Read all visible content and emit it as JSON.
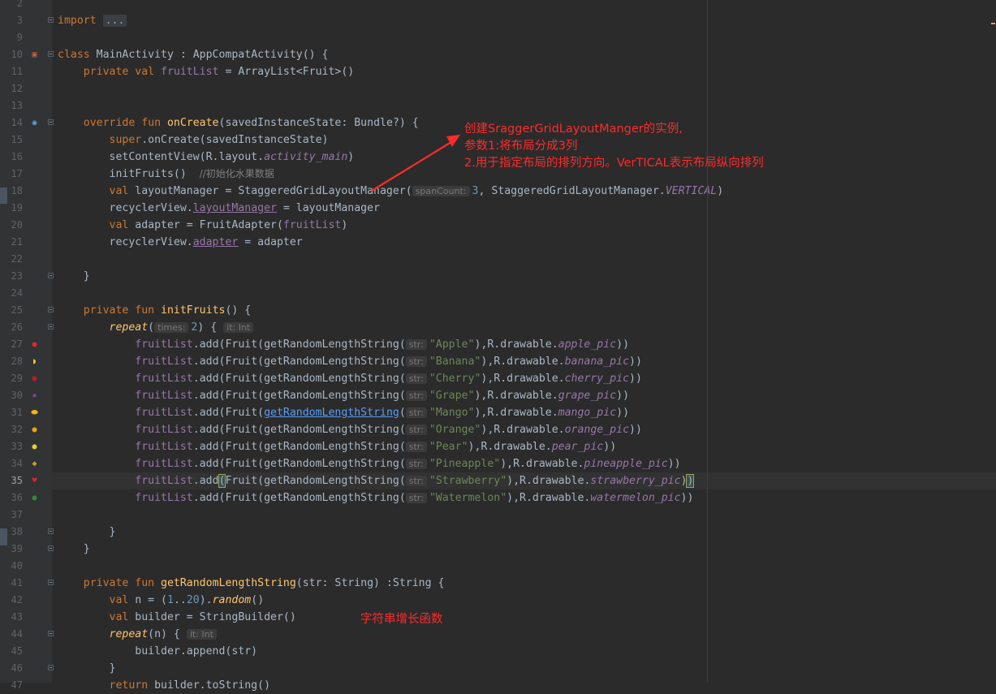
{
  "editor": {
    "language": "Kotlin",
    "colors": {
      "background": "#2b2b2b",
      "gutter": "#313335",
      "keyword": "#cc7832",
      "function": "#ffc66d",
      "property": "#9876aa",
      "string": "#6a8759",
      "number": "#6897bb",
      "annotation": "#ff2a2a"
    },
    "lines": [
      {
        "n": "2"
      },
      {
        "n": "3",
        "fold": true,
        "code": [
          {
            "t": "import ",
            "c": "kw"
          },
          {
            "t": "...",
            "c": "fold-box"
          }
        ]
      },
      {
        "n": "9"
      },
      {
        "n": "10",
        "icon": "activity-icon",
        "fold": true,
        "code": [
          {
            "t": "class ",
            "c": "kw"
          },
          {
            "t": "MainActivity : AppCompatActivity() {"
          }
        ]
      },
      {
        "n": "11",
        "code": [
          {
            "t": "    private val ",
            "c": "kw"
          },
          {
            "t": "fruitList",
            "c": "prop"
          },
          {
            "t": " = ArrayList<Fruit>()"
          }
        ]
      },
      {
        "n": "12"
      },
      {
        "n": "13"
      },
      {
        "n": "14",
        "icon": "override-icon",
        "fold": true,
        "code": [
          {
            "t": "    override fun ",
            "c": "kw"
          },
          {
            "t": "onCreate",
            "c": "fn"
          },
          {
            "t": "(savedInstanceState: Bundle?) {"
          }
        ]
      },
      {
        "n": "15",
        "code": [
          {
            "t": "        super",
            "c": "kw"
          },
          {
            "t": ".onCreate(savedInstanceState)"
          }
        ]
      },
      {
        "n": "16",
        "code": [
          {
            "t": "        setContentView(R.layout."
          },
          {
            "t": "activity_main",
            "c": "prop ital"
          },
          {
            "t": ")"
          }
        ]
      },
      {
        "n": "17",
        "code": [
          {
            "t": "        initFruits()  "
          },
          {
            "t": "//初始化水果数据",
            "c": "cmt"
          }
        ]
      },
      {
        "n": "18",
        "code": [
          {
            "t": "        val ",
            "c": "kw"
          },
          {
            "t": "layoutManager = StaggeredGridLayoutManager("
          },
          {
            "t": "spanCount:",
            "c": "hint"
          },
          {
            "t": "3",
            "c": "num"
          },
          {
            "t": ", StaggeredGridLayoutManager."
          },
          {
            "t": "VERTICAL",
            "c": "prop ital"
          },
          {
            "t": ")"
          }
        ]
      },
      {
        "n": "19",
        "code": [
          {
            "t": "        recyclerView."
          },
          {
            "t": "layoutManager",
            "c": "prop ul"
          },
          {
            "t": " = layoutManager"
          }
        ]
      },
      {
        "n": "20",
        "code": [
          {
            "t": "        val ",
            "c": "kw"
          },
          {
            "t": "adapter = FruitAdapter("
          },
          {
            "t": "fruitList",
            "c": "prop"
          },
          {
            "t": ")"
          }
        ]
      },
      {
        "n": "21",
        "code": [
          {
            "t": "        recyclerView."
          },
          {
            "t": "adapter",
            "c": "prop ul"
          },
          {
            "t": " = adapter"
          }
        ]
      },
      {
        "n": "22"
      },
      {
        "n": "23",
        "fold": true,
        "code": [
          {
            "t": "    }"
          }
        ]
      },
      {
        "n": "24"
      },
      {
        "n": "25",
        "fold": true,
        "code": [
          {
            "t": "    private fun ",
            "c": "kw"
          },
          {
            "t": "initFruits",
            "c": "fn"
          },
          {
            "t": "() {"
          }
        ]
      },
      {
        "n": "26",
        "fold": true,
        "code": [
          {
            "t": "        "
          },
          {
            "t": "repeat",
            "c": "fn ital"
          },
          {
            "t": "("
          },
          {
            "t": "times:",
            "c": "hint"
          },
          {
            "t": "2",
            "c": "num"
          },
          {
            "t": ") { "
          },
          {
            "t": "it: Int",
            "c": "hint"
          }
        ]
      },
      {
        "n": "27",
        "icon": "apple-icon",
        "code": [
          {
            "t": "            "
          },
          {
            "t": "fruitList",
            "c": "prop"
          },
          {
            "t": ".add(Fruit(getRandomLengthString("
          },
          {
            "t": "str:",
            "c": "hint"
          },
          {
            "t": "\"Apple\"",
            "c": "str"
          },
          {
            "t": "),R.drawable."
          },
          {
            "t": "apple_pic",
            "c": "prop ital"
          },
          {
            "t": "))"
          }
        ]
      },
      {
        "n": "28",
        "icon": "banana-icon",
        "code": [
          {
            "t": "            "
          },
          {
            "t": "fruitList",
            "c": "prop"
          },
          {
            "t": ".add(Fruit(getRandomLengthString("
          },
          {
            "t": "str:",
            "c": "hint"
          },
          {
            "t": "\"Banana\"",
            "c": "str"
          },
          {
            "t": "),R.drawable."
          },
          {
            "t": "banana_pic",
            "c": "prop ital"
          },
          {
            "t": "))"
          }
        ]
      },
      {
        "n": "29",
        "icon": "cherry-icon",
        "code": [
          {
            "t": "            "
          },
          {
            "t": "fruitList",
            "c": "prop"
          },
          {
            "t": ".add(Fruit(getRandomLengthString("
          },
          {
            "t": "str:",
            "c": "hint"
          },
          {
            "t": "\"Cherry\"",
            "c": "str"
          },
          {
            "t": "),R.drawable."
          },
          {
            "t": "cherry_pic",
            "c": "prop ital"
          },
          {
            "t": "))"
          }
        ]
      },
      {
        "n": "30",
        "icon": "grape-icon",
        "code": [
          {
            "t": "            "
          },
          {
            "t": "fruitList",
            "c": "prop"
          },
          {
            "t": ".add(Fruit(getRandomLengthString("
          },
          {
            "t": "str:",
            "c": "hint"
          },
          {
            "t": "\"Grape\"",
            "c": "str"
          },
          {
            "t": "),R.drawable."
          },
          {
            "t": "grape_pic",
            "c": "prop ital"
          },
          {
            "t": "))"
          }
        ]
      },
      {
        "n": "31",
        "icon": "mango-icon",
        "code": [
          {
            "t": "            "
          },
          {
            "t": "fruitList",
            "c": "prop"
          },
          {
            "t": ".add(Fruit("
          },
          {
            "t": "getRandomLengthString",
            "c": "link"
          },
          {
            "t": "("
          },
          {
            "t": "str:",
            "c": "hint"
          },
          {
            "t": "\"Mango\"",
            "c": "str"
          },
          {
            "t": "),R.drawable."
          },
          {
            "t": "mango_pic",
            "c": "prop ital"
          },
          {
            "t": "))"
          }
        ]
      },
      {
        "n": "32",
        "icon": "orange-icon",
        "code": [
          {
            "t": "            "
          },
          {
            "t": "fruitList",
            "c": "prop"
          },
          {
            "t": ".add(Fruit(getRandomLengthString("
          },
          {
            "t": "str:",
            "c": "hint"
          },
          {
            "t": "\"Orange\"",
            "c": "str"
          },
          {
            "t": "),R.drawable."
          },
          {
            "t": "orange_pic",
            "c": "prop ital"
          },
          {
            "t": "))"
          }
        ]
      },
      {
        "n": "33",
        "icon": "pear-icon",
        "code": [
          {
            "t": "            "
          },
          {
            "t": "fruitList",
            "c": "prop"
          },
          {
            "t": ".add(Fruit(getRandomLengthString("
          },
          {
            "t": "str:",
            "c": "hint"
          },
          {
            "t": "\"Pear\"",
            "c": "str"
          },
          {
            "t": "),R.drawable."
          },
          {
            "t": "pear_pic",
            "c": "prop ital"
          },
          {
            "t": "))"
          }
        ]
      },
      {
        "n": "34",
        "icon": "pineapple-icon",
        "code": [
          {
            "t": "            "
          },
          {
            "t": "fruitList",
            "c": "prop"
          },
          {
            "t": ".add(Fruit(getRandomLengthString("
          },
          {
            "t": "str:",
            "c": "hint"
          },
          {
            "t": "\"Pineapple\"",
            "c": "str"
          },
          {
            "t": "),R.drawable."
          },
          {
            "t": "pineapple_pic",
            "c": "prop ital"
          },
          {
            "t": "))"
          }
        ]
      },
      {
        "n": "35",
        "current": true,
        "icon": "strawberry-icon",
        "code": [
          {
            "t": "            "
          },
          {
            "t": "fruitList",
            "c": "prop"
          },
          {
            "t": ".add"
          },
          {
            "t": "(",
            "c": "bracket"
          },
          {
            "t": "Fruit(getRandomLengthString("
          },
          {
            "t": "str:",
            "c": "hint"
          },
          {
            "t": "\"Strawberry\"",
            "c": "str"
          },
          {
            "t": "),R.drawable."
          },
          {
            "t": "strawberry_pic",
            "c": "prop ital"
          },
          {
            "t": ")"
          },
          {
            "t": ")",
            "c": "bracket"
          }
        ]
      },
      {
        "n": "36",
        "icon": "watermelon-icon",
        "code": [
          {
            "t": "            "
          },
          {
            "t": "fruitList",
            "c": "prop"
          },
          {
            "t": ".add(Fruit(getRandomLengthString("
          },
          {
            "t": "str:",
            "c": "hint"
          },
          {
            "t": "\"Watermelon\"",
            "c": "str"
          },
          {
            "t": "),R.drawable."
          },
          {
            "t": "watermelon_pic",
            "c": "prop ital"
          },
          {
            "t": "))"
          }
        ]
      },
      {
        "n": "37"
      },
      {
        "n": "38",
        "fold": true,
        "code": [
          {
            "t": "        }"
          }
        ]
      },
      {
        "n": "39",
        "fold": true,
        "code": [
          {
            "t": "    }"
          }
        ]
      },
      {
        "n": "40"
      },
      {
        "n": "41",
        "fold": true,
        "code": [
          {
            "t": "    private fun ",
            "c": "kw"
          },
          {
            "t": "getRandomLengthString",
            "c": "fn"
          },
          {
            "t": "(str: String) :String {"
          }
        ]
      },
      {
        "n": "42",
        "code": [
          {
            "t": "        val ",
            "c": "kw"
          },
          {
            "t": "n = ("
          },
          {
            "t": "1",
            "c": "num"
          },
          {
            "t": ".."
          },
          {
            "t": "20",
            "c": "num"
          },
          {
            "t": ")."
          },
          {
            "t": "random",
            "c": "fn ital"
          },
          {
            "t": "()"
          }
        ]
      },
      {
        "n": "43",
        "code": [
          {
            "t": "        val ",
            "c": "kw"
          },
          {
            "t": "builder = StringBuilder()"
          }
        ]
      },
      {
        "n": "44",
        "fold": true,
        "code": [
          {
            "t": "        "
          },
          {
            "t": "repeat",
            "c": "fn ital"
          },
          {
            "t": "(n) { "
          },
          {
            "t": "it: Int",
            "c": "hint"
          }
        ]
      },
      {
        "n": "45",
        "code": [
          {
            "t": "            builder.append(str)"
          }
        ]
      },
      {
        "n": "46",
        "fold": true,
        "code": [
          {
            "t": "        }"
          }
        ]
      },
      {
        "n": "47",
        "code": [
          {
            "t": "        return ",
            "c": "kw"
          },
          {
            "t": "builder.toString()"
          }
        ]
      }
    ]
  },
  "annotations": {
    "note_1_line_1": "创建SraggerGridLayoutManger的实例,",
    "note_1_line_2": "参数1:将布局分成3列",
    "note_1_line_3": "2.用于指定布局的排列方向。VerTICAL表示布局纵向排列",
    "note_2": "字符串增长函数",
    "color": "#ff2a2a"
  }
}
